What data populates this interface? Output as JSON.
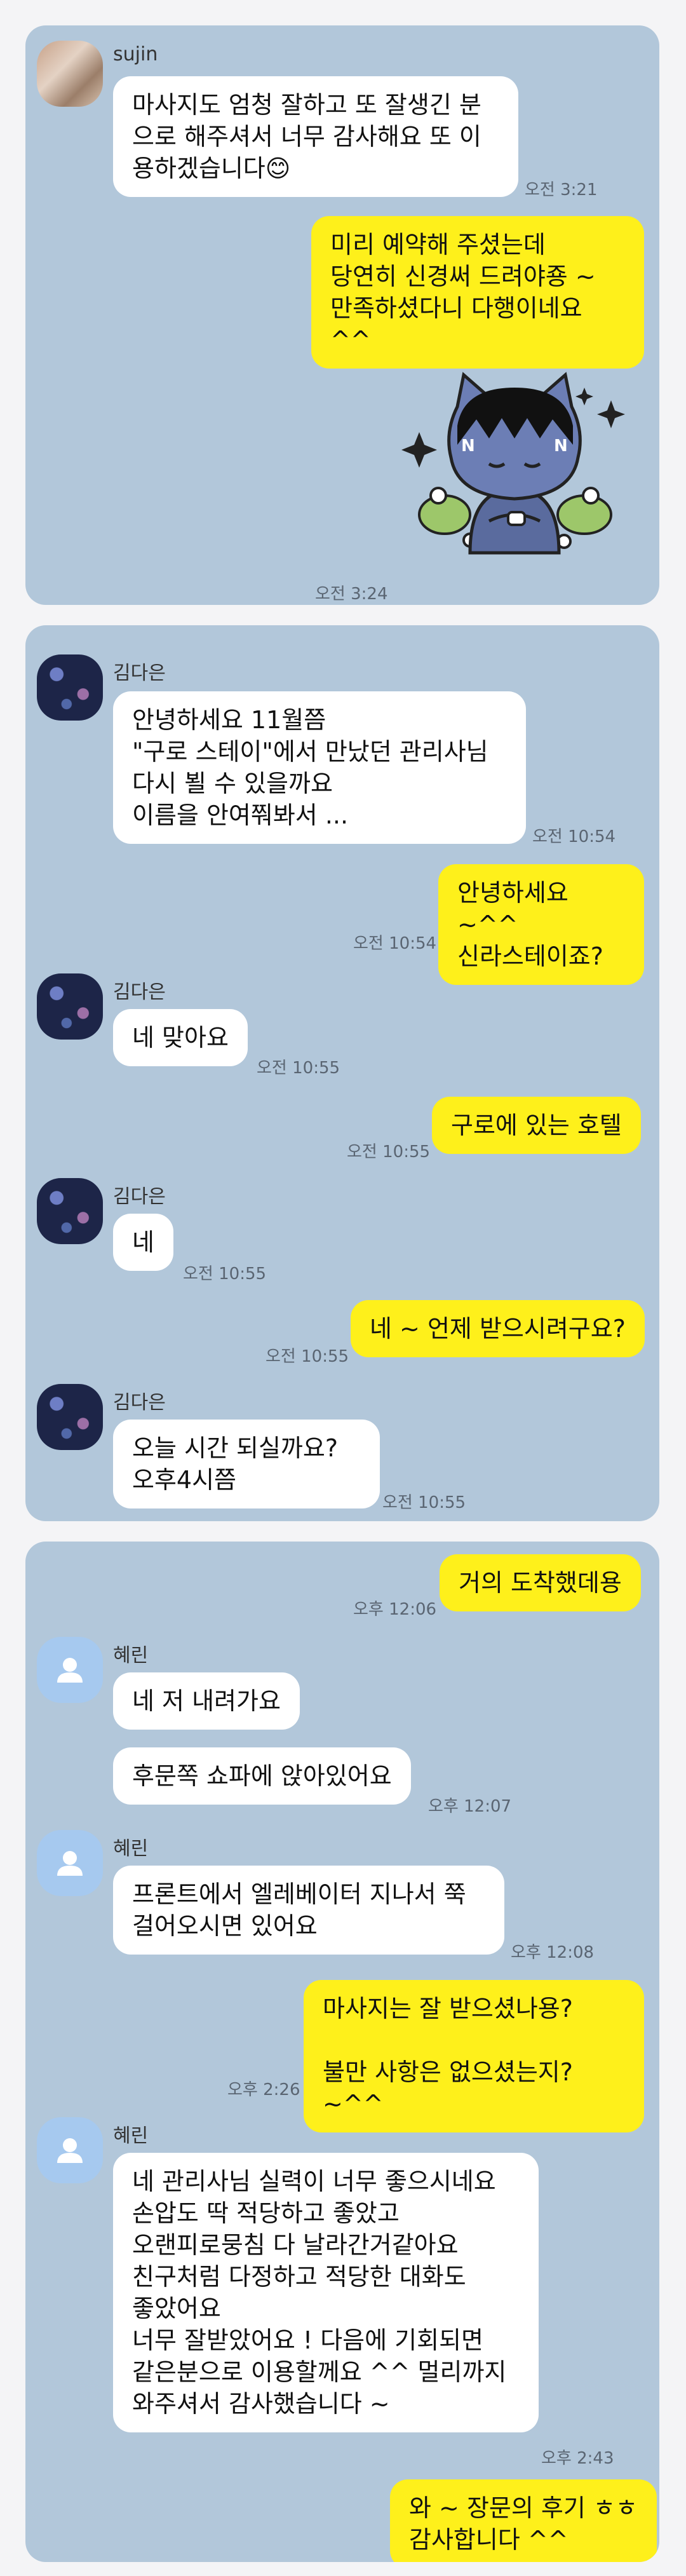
{
  "card1": {
    "sender_name": "sujin",
    "msg1": "마사지도 엄청 잘하고 또 잘생긴 분\n으로 해주셔서 너무 감사해요 또 이\n용하겠습니다😊",
    "time1": "오전 3:21",
    "reply1": "미리 예약해 주셨는데\n당연히 신경써 드려야죵 ~\n만족하셨다니 다행이네요 ^^",
    "sticker_icon": "ryan-sticker-icon",
    "time2": "오전 3:24"
  },
  "card2": {
    "sender_name": "김다은",
    "msg1": "안녕하세요 11월쯤\n\"구로 스테이\"에서 만났던 관리사님\n다시 뵐 수 있을까요\n이름을 안여쭤봐서 ...",
    "time1": "오전 10:54",
    "reply1": "안녕하세요 ~^^\n신라스테이죠?",
    "time2": "오전 10:54",
    "msg2": "네 맞아요",
    "time3": "오전 10:55",
    "reply2": "구로에 있는 호텔",
    "time4": "오전 10:55",
    "msg3": "네",
    "time5": "오전 10:55",
    "reply3": "네 ~ 언제 받으시려구요?",
    "time6": "오전 10:55",
    "msg4": "오늘  시간 되실까요?\n오후4시쯤",
    "time7": "오전 10:55"
  },
  "card3": {
    "sender_name": "혜린",
    "reply1": "거의 도착했데용",
    "time1": "오후 12:06",
    "msg1": "네 저 내려가요",
    "msg2": "후문쪽 쇼파에 앉아있어요",
    "time2": "오후 12:07",
    "msg3": "프론트에서 엘레베이터 지나서 쭉\n걸어오시면 있어요",
    "time3": "오후 12:08",
    "reply2": "마사지는 잘 받으셨나용?\n\n불만 사항은 없으셨는지? ~^^",
    "time4": "오후 2:26",
    "msg4": "네 관리사님 실력이 너무 좋으시네요\n손압도 딱 적당하고 좋았고\n오랜피로뭉침 다 날라간거같아요\n친구처럼 다정하고 적당한 대화도\n좋았어요\n너무 잘받았어요 ! 다음에 기회되면\n같은분으로 이용할께요 ^^ 멀리까지\n와주셔서 감사했습니다 ~",
    "time5": "오후 2:43",
    "reply3": "와 ~ 장문의 후기 ㅎㅎ\n감사합니다 ^^"
  },
  "avatar_icon": "person-icon",
  "colors": {
    "card_bg": "#b2c7da",
    "page_bg": "#f4f4f6",
    "incoming_bubble": "#ffffff",
    "outgoing_bubble": "#fef01b"
  }
}
